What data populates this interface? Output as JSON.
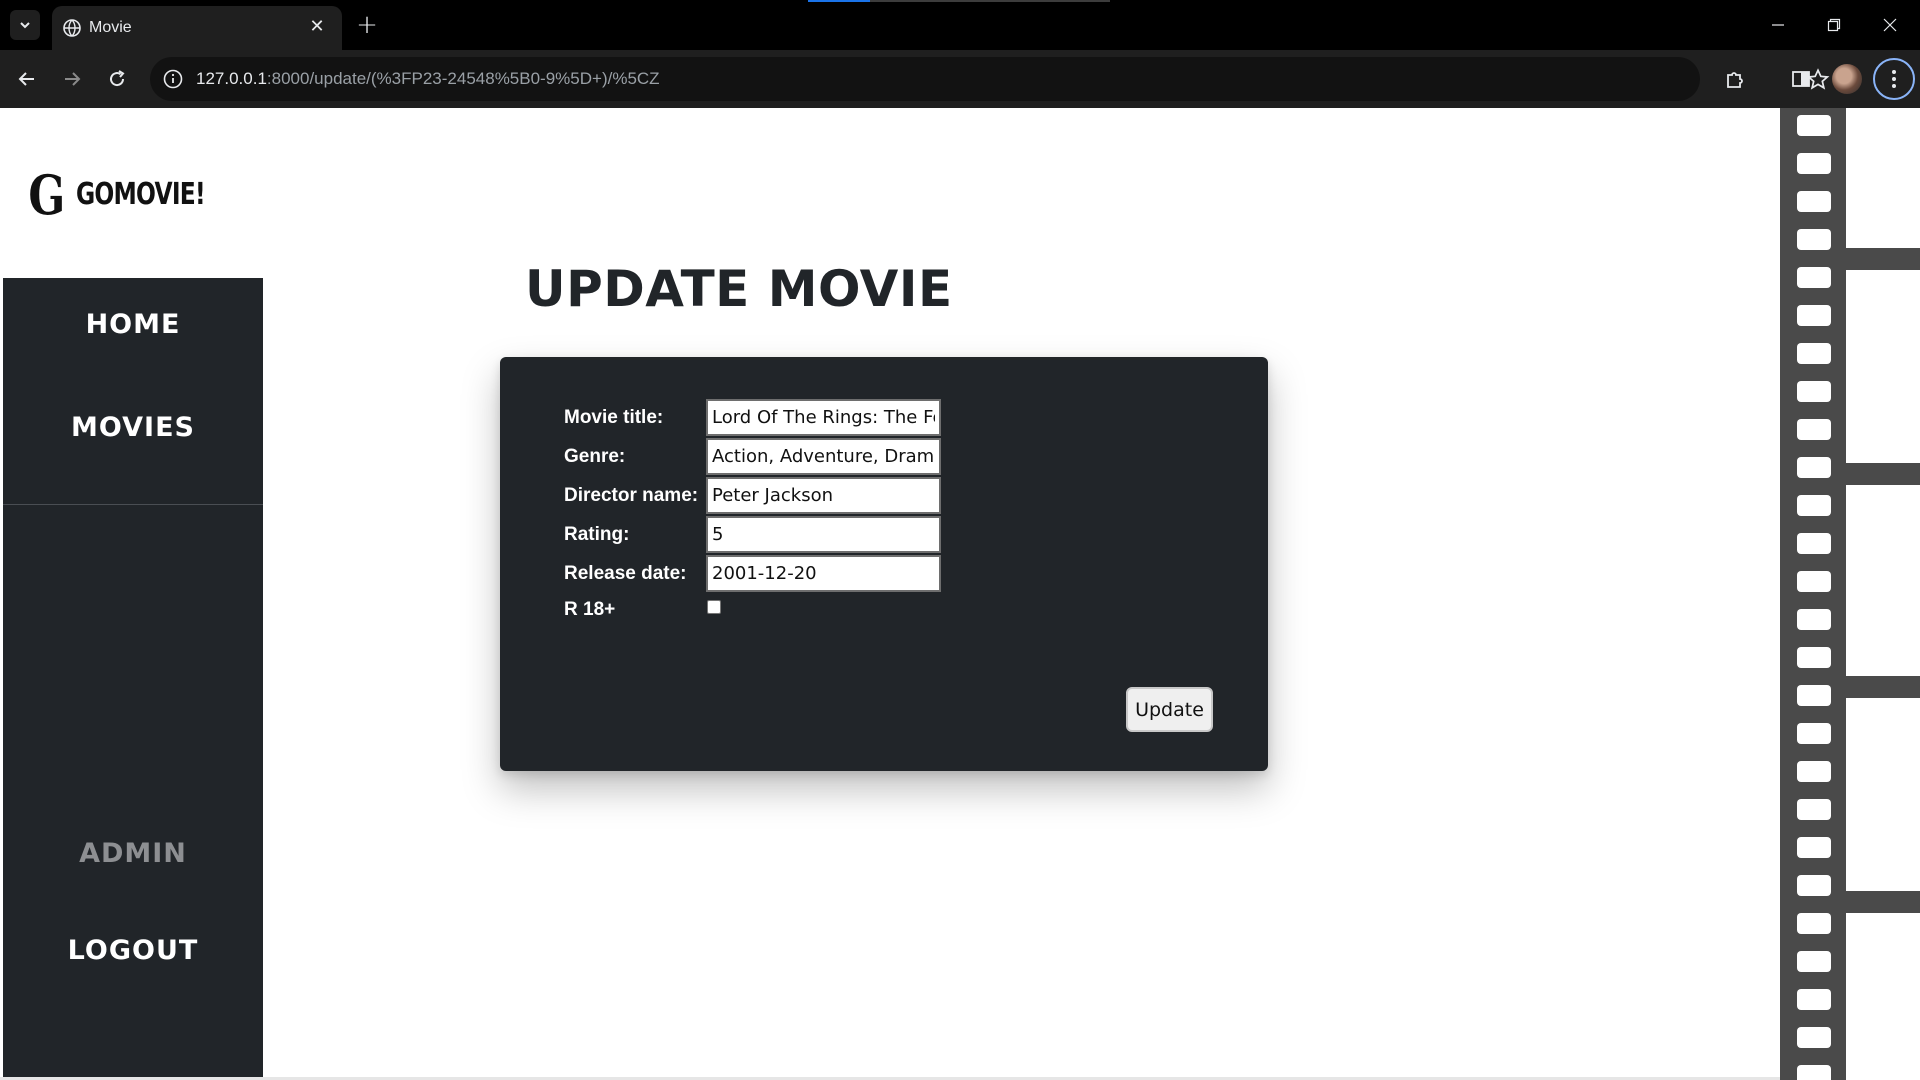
{
  "browser": {
    "tab_title": "Movie",
    "url_host": "127.0.0.1",
    "url_rest": ":8000/update/(%3FP23-24548%5B0-9%5D+)/%5CZ"
  },
  "sidebar": {
    "logo_letter": "G",
    "logo_text": "GOMOVIE!",
    "nav": {
      "home": "HOME",
      "movies": "MOVIES",
      "admin": "ADMIN",
      "logout": "LOGOUT"
    }
  },
  "main": {
    "heading": "UPDATE MOVIE",
    "form": {
      "title_label": "Movie title:",
      "title_value": "Lord Of The Rings: The Fe",
      "genre_label": "Genre:",
      "genre_value": "Action, Adventure, Drama",
      "director_label": "Director name:",
      "director_value": "Peter Jackson",
      "rating_label": "Rating:",
      "rating_value": "5",
      "release_label": "Release date:",
      "release_value": "2001-12-20",
      "r18_label": "R 18+",
      "r18_checked": false,
      "submit_label": "Update"
    }
  },
  "colors": {
    "sidebar_bg": "#212529",
    "card_bg": "#212529",
    "heading": "#212529",
    "admin_muted": "#8d8f92",
    "filmstrip": "#4a4a4a"
  }
}
